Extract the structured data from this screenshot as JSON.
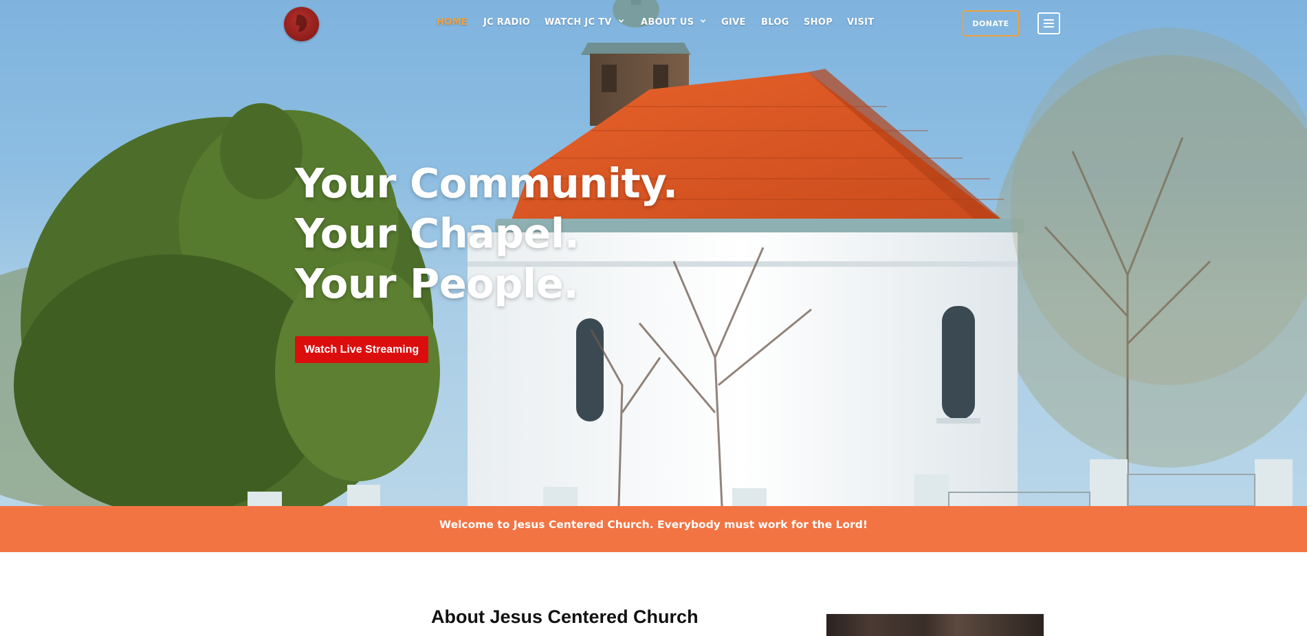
{
  "nav": {
    "items": [
      {
        "label": "HOME",
        "active": true
      },
      {
        "label": "JC RADIO"
      },
      {
        "label": "WATCH JC TV",
        "dropdown": true
      },
      {
        "label": "ABOUT US",
        "dropdown": true
      },
      {
        "label": "GIVE"
      },
      {
        "label": "BLOG"
      },
      {
        "label": "SHOP"
      },
      {
        "label": "VISIT"
      }
    ],
    "donate_label": "DONATE",
    "logo_icon": "church-logo-icon",
    "menu_icon": "hamburger-menu-icon"
  },
  "hero": {
    "headline": [
      "Your Community.",
      "Your Chapel.",
      "Your People."
    ],
    "cta_label": "Watch Live Streaming"
  },
  "banner": {
    "text": "Welcome to Jesus Centered Church. Everybody must work for the Lord!"
  },
  "about": {
    "title": "About Jesus Centered Church"
  },
  "colors": {
    "accent": "#f1a13a",
    "cta": "#dc0d0d",
    "banner": "#f27443",
    "logo": "#8e1d1a"
  }
}
